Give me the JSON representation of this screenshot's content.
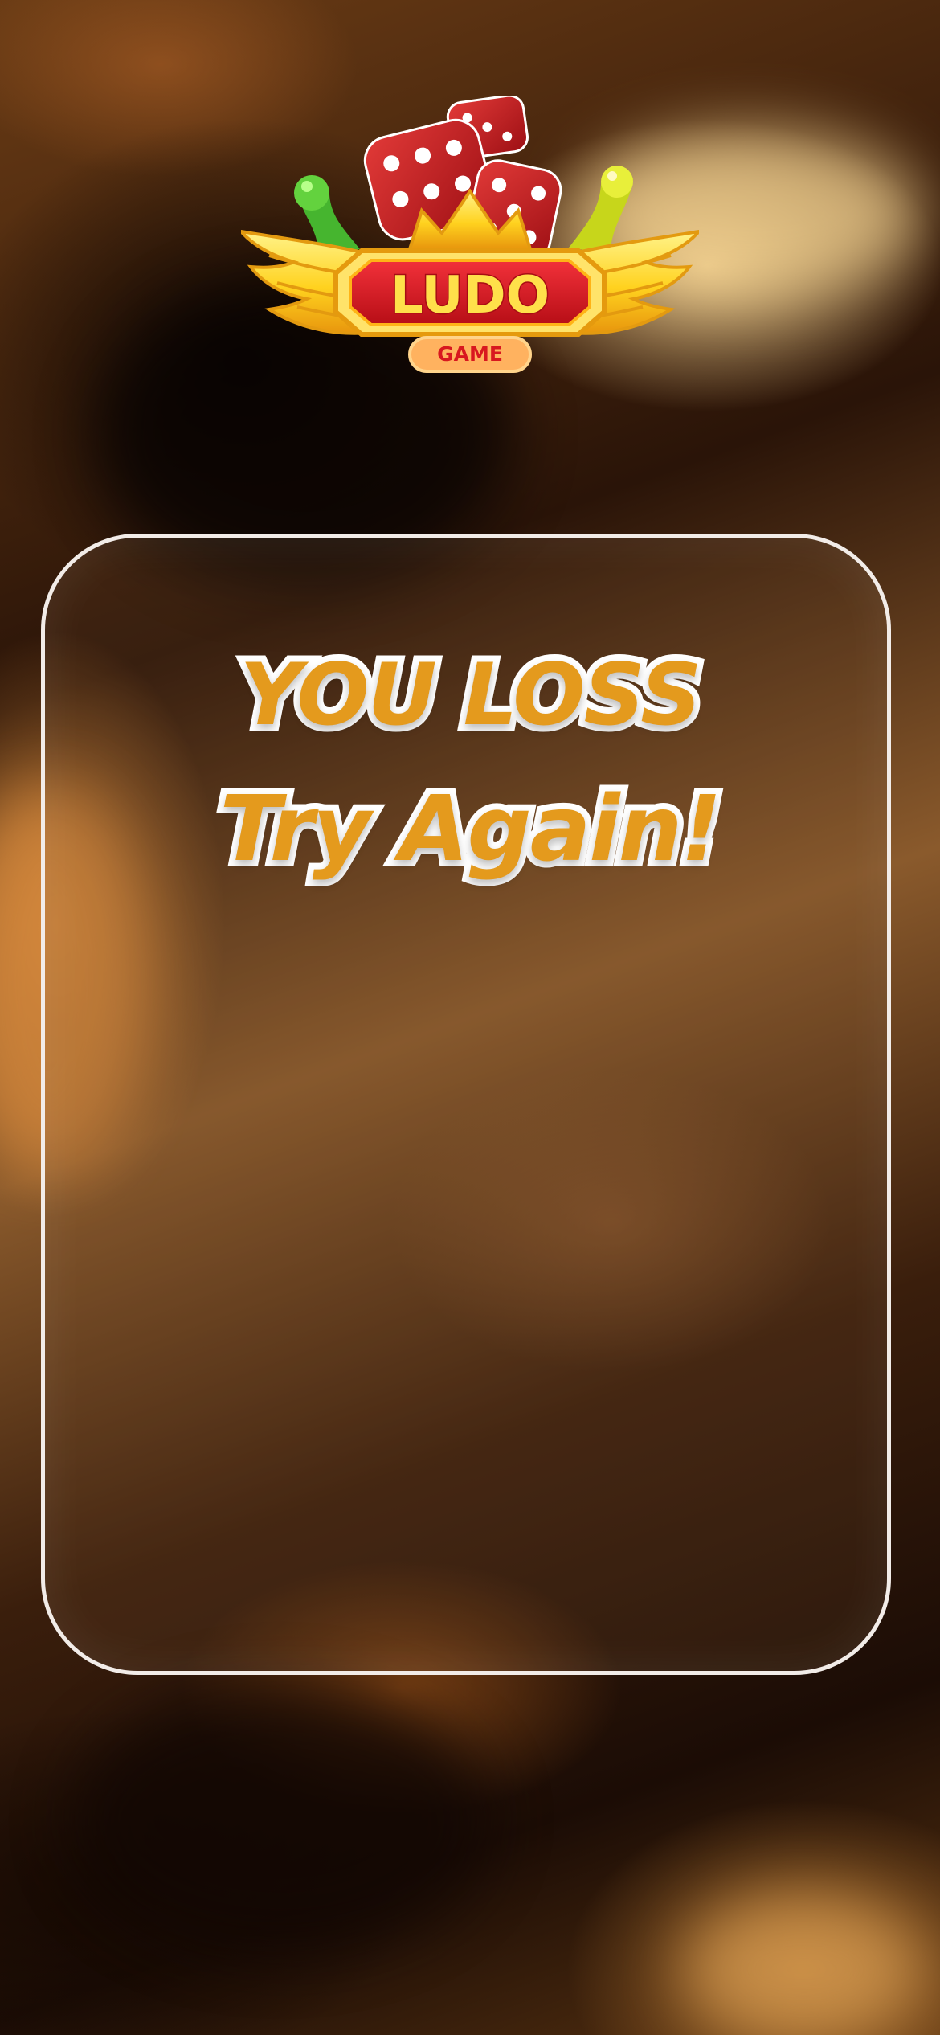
{
  "logo": {
    "main_text": "LUDO",
    "sub_text": "GAME"
  },
  "result": {
    "headline": "YOU LOSS",
    "subline": "Try Again!"
  },
  "colors": {
    "title_fill": "#e49a1d",
    "title_outline": "#ffffff",
    "panel_border": "#f2ece8",
    "logo_red": "#d7161f",
    "logo_yellow": "#ffd21f"
  }
}
